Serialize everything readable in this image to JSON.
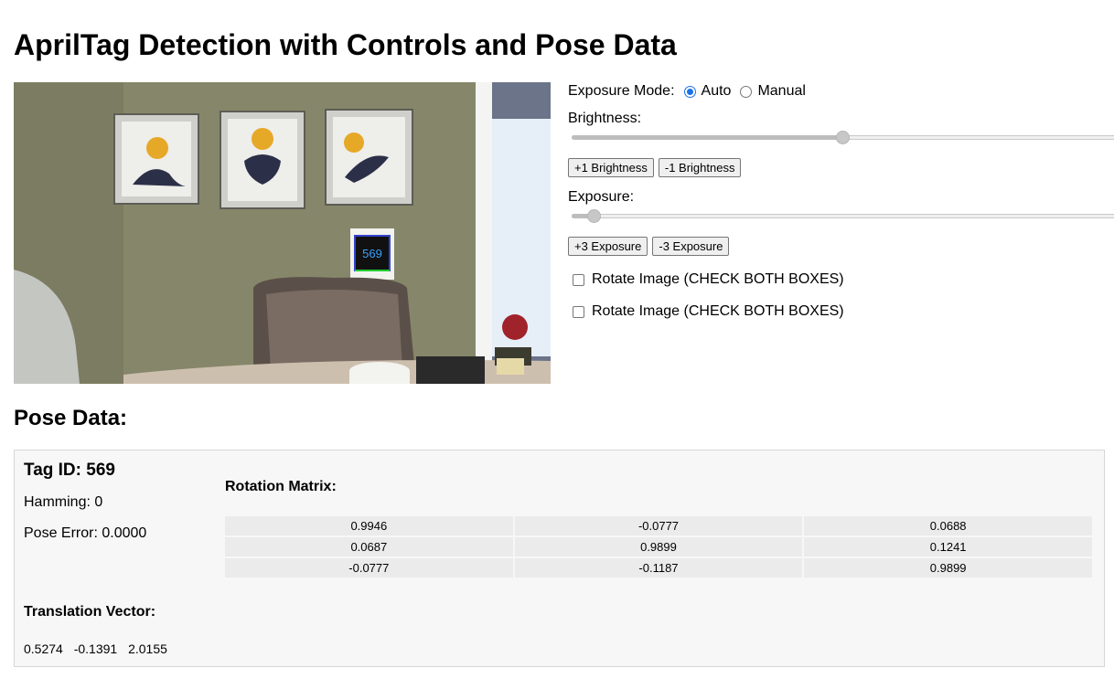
{
  "page_title": "AprilTag Detection with Controls and Pose Data",
  "camera": {
    "tag_overlay_text": "569"
  },
  "controls": {
    "exposure_mode_label": "Exposure Mode:",
    "mode_options": [
      "Auto",
      "Manual"
    ],
    "mode_selected": "Auto",
    "brightness_label": "Brightness:",
    "brightness_level": 0.5,
    "brightness_buttons": [
      "+1 Brightness",
      "-1 Brightness"
    ],
    "exposure_label": "Exposure:",
    "exposure_level": 0.04,
    "exposure_buttons": [
      "+3 Exposure",
      "-3 Exposure"
    ],
    "rotate_checkboxes": [
      {
        "label": "Rotate Image (CHECK BOTH BOXES)",
        "checked": false
      },
      {
        "label": "Rotate Image (CHECK BOTH BOXES)",
        "checked": false
      }
    ]
  },
  "pose": {
    "section_title": "Pose Data:",
    "tag_id": "Tag ID: 569",
    "hamming": "Hamming: 0",
    "pose_error": "Pose Error: 0.0000",
    "rotation_title": "Rotation Matrix:",
    "rotation_matrix": [
      [
        "0.9946",
        "-0.0777",
        "0.0688"
      ],
      [
        "0.0687",
        "0.9899",
        "0.1241"
      ],
      [
        "-0.0777",
        "-0.1187",
        "0.9899"
      ]
    ],
    "translation_title": "Translation Vector:",
    "translation_vector": [
      "0.5274",
      "-0.1391",
      "2.0155"
    ]
  },
  "colors": {
    "radio_accent": "#1a73e8",
    "panel_bg": "#f7f7f7",
    "cell_bg": "#ebebeb"
  }
}
